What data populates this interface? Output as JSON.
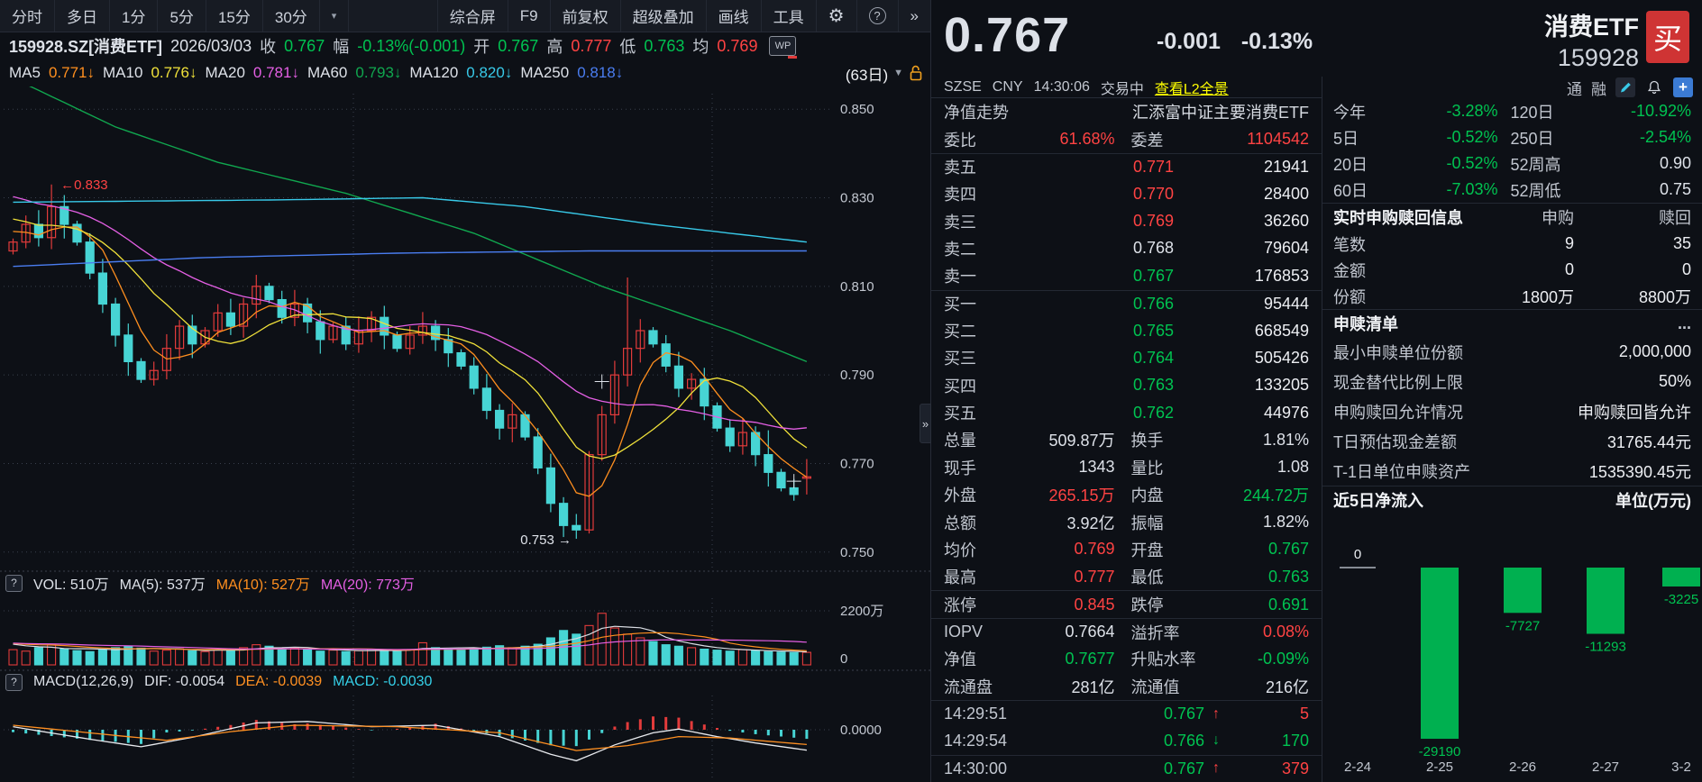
{
  "colors": {
    "bg": "#0d1016",
    "red": "#ff4343",
    "green": "#00c351",
    "white": "#f0f2f5",
    "textMain": "#dde1e8",
    "textLabel": "#c2c7d0",
    "yellow": "#ffff00",
    "candleUp": "#e23b3b",
    "candleDown": "#47d4d4",
    "ma5": "#ff8f1f",
    "ma10": "#f0e13a",
    "ma20": "#e45fe4",
    "ma60": "#10a74f",
    "ma120": "#38c9e8",
    "ma250": "#4a7df0",
    "difLine": "#e8eaee",
    "deaLine": "#ff9022",
    "macdCyan": "#35d0e8",
    "grid": "#39404d",
    "axisText": "#c2c7d0",
    "lock": "#f0a01e",
    "linkBlue": "#3b7bd4"
  },
  "toolbar": {
    "left_tabs": [
      {
        "label": "分时",
        "name": "tab-timeshare"
      },
      {
        "label": "多日",
        "name": "tab-multiday"
      },
      {
        "label": "1分",
        "name": "tab-1min"
      },
      {
        "label": "5分",
        "name": "tab-5min"
      },
      {
        "label": "15分",
        "name": "tab-15min"
      },
      {
        "label": "30分",
        "name": "tab-30min"
      },
      {
        "label": "▾",
        "name": "tab-period-dropdown"
      }
    ],
    "right_tools": [
      {
        "label": "综合屏",
        "name": "tool-composite-screen"
      },
      {
        "label": "F9",
        "name": "tool-f9"
      },
      {
        "label": "前复权",
        "name": "tool-forward-adjust"
      },
      {
        "label": "超级叠加",
        "name": "tool-super-overlay"
      },
      {
        "label": "画线",
        "name": "tool-draw-line"
      },
      {
        "label": "工具",
        "name": "tool-tools"
      }
    ],
    "gear": "⚙",
    "help": "?",
    "more": "»"
  },
  "info_row": {
    "segments": [
      {
        "t": "159928.SZ[消费ETF]",
        "c": "w",
        "b": 1
      },
      {
        "t": "2026/03/03",
        "c": "w"
      },
      {
        "t": "收",
        "c": "l"
      },
      {
        "t": "0.767",
        "c": "g"
      },
      {
        "t": "幅",
        "c": "l"
      },
      {
        "t": "-0.13%(-0.001)",
        "c": "g"
      },
      {
        "t": "开",
        "c": "l"
      },
      {
        "t": "0.767",
        "c": "g"
      },
      {
        "t": "高",
        "c": "l"
      },
      {
        "t": "0.777",
        "c": "r"
      },
      {
        "t": "低",
        "c": "l"
      },
      {
        "t": "0.763",
        "c": "g"
      },
      {
        "t": "均",
        "c": "l"
      },
      {
        "t": "0.769",
        "c": "r"
      }
    ],
    "wp_label": "WP"
  },
  "ma_row": {
    "segments": [
      {
        "t": "MA5",
        "c": "w"
      },
      {
        "t": "0.771↓",
        "c": "ma5"
      },
      {
        "t": "MA10",
        "c": "w"
      },
      {
        "t": "0.776↓",
        "c": "ma10"
      },
      {
        "t": "MA20",
        "c": "w"
      },
      {
        "t": "0.781↓",
        "c": "ma20"
      },
      {
        "t": "MA60",
        "c": "w"
      },
      {
        "t": "0.793↓",
        "c": "ma60"
      },
      {
        "t": "MA120",
        "c": "w"
      },
      {
        "t": "0.820↓",
        "c": "ma120"
      },
      {
        "t": "MA250",
        "c": "w"
      },
      {
        "t": "0.818↓",
        "c": "ma250"
      }
    ],
    "range_label": "(63日)",
    "range_caret": "▼"
  },
  "vol_legend": [
    {
      "t": "VOL: 510万",
      "c": "w"
    },
    {
      "t": "MA(5): 537万",
      "c": "w"
    },
    {
      "t": "MA(10): 527万",
      "c": "ma5"
    },
    {
      "t": "MA(20): 773万",
      "c": "ma20"
    }
  ],
  "macd_legend": [
    {
      "t": "MACD(12,26,9)",
      "c": "w"
    },
    {
      "t": "DIF: -0.0054",
      "c": "w"
    },
    {
      "t": "DEA: -0.0039",
      "c": "deaLine"
    },
    {
      "t": "MACD: -0.0030",
      "c": "macdCyan"
    }
  ],
  "quote_panel": {
    "price": "0.767",
    "change": "-0.001",
    "pct": "-0.13%",
    "name": "消费ETF",
    "code": "159928",
    "buy_label": "买",
    "exchange": "SZSE",
    "currency": "CNY",
    "time": "14:30:06",
    "status": "交易中",
    "l2_link": "查看L2全景",
    "nav_label": "净值走势",
    "nav_value": "汇添富中证主要消费ETF",
    "weibi": {
      "l1": "委比",
      "v1": "61.68%",
      "c1": "r",
      "l2": "委差",
      "v2": "1104542",
      "c2": "r"
    },
    "sells": [
      {
        "label": "卖五",
        "price": "0.771",
        "pc": "r",
        "qty": "21941"
      },
      {
        "label": "卖四",
        "price": "0.770",
        "pc": "r",
        "qty": "28400"
      },
      {
        "label": "卖三",
        "price": "0.769",
        "pc": "r",
        "qty": "36260"
      },
      {
        "label": "卖二",
        "price": "0.768",
        "pc": "w",
        "qty": "79604"
      },
      {
        "label": "卖一",
        "price": "0.767",
        "pc": "g",
        "qty": "176853"
      }
    ],
    "buys": [
      {
        "label": "买一",
        "price": "0.766",
        "pc": "g",
        "qty": "95444"
      },
      {
        "label": "买二",
        "price": "0.765",
        "pc": "g",
        "qty": "668549"
      },
      {
        "label": "买三",
        "price": "0.764",
        "pc": "g",
        "qty": "505426"
      },
      {
        "label": "买四",
        "price": "0.763",
        "pc": "g",
        "qty": "133205"
      },
      {
        "label": "买五",
        "price": "0.762",
        "pc": "g",
        "qty": "44976"
      }
    ],
    "stats": [
      {
        "l1": "总量",
        "v1": "509.87万",
        "c1": "w",
        "l2": "换手",
        "v2": "1.81%",
        "c2": "w"
      },
      {
        "l1": "现手",
        "v1": "1343",
        "c1": "w",
        "l2": "量比",
        "v2": "1.08",
        "c2": "w"
      },
      {
        "l1": "外盘",
        "v1": "265.15万",
        "c1": "r",
        "l2": "内盘",
        "v2": "244.72万",
        "c2": "g"
      },
      {
        "l1": "总额",
        "v1": "3.92亿",
        "c1": "w",
        "l2": "振幅",
        "v2": "1.82%",
        "c2": "w"
      },
      {
        "l1": "均价",
        "v1": "0.769",
        "c1": "r",
        "l2": "开盘",
        "v2": "0.767",
        "c2": "g"
      },
      {
        "l1": "最高",
        "v1": "0.777",
        "c1": "r",
        "l2": "最低",
        "v2": "0.763",
        "c2": "g"
      },
      {
        "l1": "涨停",
        "v1": "0.845",
        "c1": "r",
        "l2": "跌停",
        "v2": "0.691",
        "c2": "g",
        "line": 1
      },
      {
        "l1": "IOPV",
        "v1": "0.7664",
        "c1": "w",
        "l2": "溢折率",
        "v2": "0.08%",
        "c2": "r",
        "line": 1
      },
      {
        "l1": "净值",
        "v1": "0.7677",
        "c1": "g",
        "l2": "升贴水率",
        "v2": "-0.09%",
        "c2": "g"
      },
      {
        "l1": "流通盘",
        "v1": "281亿",
        "c1": "w",
        "l2": "流通值",
        "v2": "216亿",
        "c2": "w"
      }
    ],
    "ticks": [
      {
        "time": "14:29:51",
        "price": "0.767",
        "pc": "g",
        "dir": "↑",
        "dc": "r",
        "qty": "5",
        "qc": "r",
        "line": 1
      },
      {
        "time": "14:29:54",
        "price": "0.766",
        "pc": "g",
        "dir": "↓",
        "dc": "g",
        "qty": "170",
        "qc": "g"
      },
      {
        "time": "14:30:00",
        "price": "0.767",
        "pc": "g",
        "dir": "↑",
        "dc": "r",
        "qty": "379",
        "qc": "r",
        "line": 1
      }
    ]
  },
  "right_panel": {
    "margin_tags": [
      "通",
      "融"
    ],
    "perf": [
      {
        "l1": "今年",
        "v1": "-3.28%",
        "c1": "g",
        "l2": "120日",
        "v2": "-10.92%",
        "c2": "g"
      },
      {
        "l1": "5日",
        "v1": "-0.52%",
        "c1": "g",
        "l2": "250日",
        "v2": "-2.54%",
        "c2": "g"
      },
      {
        "l1": "20日",
        "v1": "-0.52%",
        "c1": "g",
        "l2": "52周高",
        "v2": "0.90",
        "c2": "w"
      },
      {
        "l1": "60日",
        "v1": "-7.03%",
        "c1": "g",
        "l2": "52周低",
        "v2": "0.75",
        "c2": "w"
      }
    ],
    "subs_header": {
      "title": "实时申购赎回信息",
      "col1": "申购",
      "col2": "赎回"
    },
    "subs": [
      {
        "label": "笔数",
        "v1": "9",
        "v2": "35"
      },
      {
        "label": "金额",
        "v1": "0",
        "v2": "0"
      },
      {
        "label": "份额",
        "v1": "1800万",
        "v2": "8800万"
      }
    ],
    "list_header": {
      "title": "申赎清单",
      "more": "..."
    },
    "list": [
      {
        "label": "最小申赎单位份额",
        "value": "2,000,000"
      },
      {
        "label": "现金替代比例上限",
        "value": "50%"
      },
      {
        "label": "申购赎回允许情况",
        "value": "申购赎回皆允许"
      },
      {
        "label": "T日预估现金差额",
        "value": "31765.44元"
      },
      {
        "label": "T-1日单位申赎资产",
        "value": "1535390.45元"
      }
    ],
    "flow_header": {
      "title": "近5日净流入",
      "unit": "单位(万元)"
    }
  },
  "chart_data": [
    {
      "type": "candlestick",
      "title": "159928.SZ 消费ETF 日K",
      "bars_visible": 63,
      "price_axis_labels": [
        "0.850",
        "0.830",
        "0.810",
        "0.790",
        "0.770",
        "0.750"
      ],
      "price_ticks": [
        0.85,
        0.83,
        0.81,
        0.79,
        0.77,
        0.75
      ],
      "high_annotation": "0.833",
      "low_annotation": "0.753",
      "pre_closes": [
        0.84,
        0.839,
        0.838,
        0.8375,
        0.837,
        0.836,
        0.835,
        0.834,
        0.8335,
        0.832,
        0.831,
        0.83,
        0.829,
        0.828,
        0.827,
        0.826,
        0.825,
        0.824,
        0.822,
        0.821
      ],
      "first_open": 0.818,
      "closes": [
        0.82,
        0.824,
        0.821,
        0.828,
        0.824,
        0.82,
        0.813,
        0.806,
        0.799,
        0.793,
        0.789,
        0.791,
        0.796,
        0.801,
        0.797,
        0.8,
        0.804,
        0.801,
        0.806,
        0.81,
        0.807,
        0.803,
        0.806,
        0.802,
        0.798,
        0.801,
        0.797,
        0.8,
        0.803,
        0.799,
        0.796,
        0.799,
        0.801,
        0.798,
        0.795,
        0.792,
        0.787,
        0.782,
        0.778,
        0.781,
        0.776,
        0.769,
        0.761,
        0.756,
        0.755,
        0.772,
        0.781,
        0.79,
        0.796,
        0.8,
        0.797,
        0.792,
        0.787,
        0.789,
        0.783,
        0.778,
        0.774,
        0.777,
        0.772,
        0.768,
        0.7645,
        0.763,
        0.767
      ],
      "overrides": {
        "3": {
          "h": 0.833
        },
        "44": {
          "l": 0.753
        },
        "48": {
          "h": 0.812
        },
        "59": {
          "h": 0.7775
        },
        "62": {
          "o": 0.767,
          "h": 0.771,
          "l": 0.763,
          "c": 0.767
        }
      },
      "ma60_points": [
        [
          0,
          0.857
        ],
        [
          8,
          0.846
        ],
        [
          16,
          0.838
        ],
        [
          26,
          0.831
        ],
        [
          36,
          0.822
        ],
        [
          46,
          0.81
        ],
        [
          56,
          0.8
        ],
        [
          62,
          0.793
        ]
      ],
      "ma120_points": [
        [
          0,
          0.829
        ],
        [
          20,
          0.8295
        ],
        [
          32,
          0.83
        ],
        [
          40,
          0.828
        ],
        [
          50,
          0.824
        ],
        [
          62,
          0.82
        ]
      ],
      "ma250_points": [
        [
          0,
          0.8145
        ],
        [
          15,
          0.8165
        ],
        [
          30,
          0.8175
        ],
        [
          45,
          0.818
        ],
        [
          62,
          0.818
        ]
      ]
    },
    {
      "type": "bar",
      "title": "成交量",
      "vol_axis_labels": [
        "2200万",
        "0"
      ],
      "vol_axis_max": 2200,
      "volumes": [
        620,
        560,
        700,
        820,
        640,
        580,
        540,
        620,
        700,
        760,
        680,
        560,
        600,
        660,
        580,
        540,
        620,
        580,
        700,
        820,
        760,
        640,
        700,
        620,
        560,
        600,
        540,
        580,
        640,
        600,
        560,
        620,
        900,
        700,
        640,
        600,
        660,
        720,
        780,
        700,
        760,
        840,
        1100,
        1400,
        1250,
        1600,
        2100,
        1500,
        1250,
        1100,
        950,
        820,
        760,
        700,
        640,
        600,
        560,
        620,
        580,
        540,
        520,
        500,
        510
      ]
    },
    {
      "type": "line",
      "title": "MACD(12,26,9)",
      "zero_axis_label": "0.0000",
      "dif_points": [
        [
          0,
          0.0008
        ],
        [
          6,
          -0.0025
        ],
        [
          10,
          -0.0045
        ],
        [
          14,
          -0.002
        ],
        [
          19,
          0.0018
        ],
        [
          23,
          0.0022
        ],
        [
          28,
          0.0008
        ],
        [
          33,
          0.0012
        ],
        [
          38,
          -0.0018
        ],
        [
          42,
          -0.0065
        ],
        [
          44,
          -0.0082
        ],
        [
          47,
          -0.004
        ],
        [
          50,
          -0.0008
        ],
        [
          52,
          0.0002
        ],
        [
          55,
          -0.0018
        ],
        [
          58,
          -0.0035
        ],
        [
          62,
          -0.0054
        ]
      ],
      "dea_points": [
        [
          0,
          0.0012
        ],
        [
          8,
          -0.0015
        ],
        [
          12,
          -0.0028
        ],
        [
          17,
          -0.0005
        ],
        [
          22,
          0.0012
        ],
        [
          30,
          0.0008
        ],
        [
          38,
          -0.0008
        ],
        [
          44,
          -0.0055
        ],
        [
          48,
          -0.0042
        ],
        [
          52,
          -0.0018
        ],
        [
          56,
          -0.0022
        ],
        [
          62,
          -0.0039
        ]
      ]
    },
    {
      "type": "bar",
      "title": "近5日净流入(万元)",
      "categories": [
        "2-24",
        "2-25",
        "2-26",
        "2-27",
        "3-2"
      ],
      "values": [
        0,
        -29190,
        -7727,
        -11293,
        -3225
      ],
      "value_labels": [
        "0",
        "-29190",
        "-7727",
        "-11293",
        "-3225"
      ]
    }
  ]
}
